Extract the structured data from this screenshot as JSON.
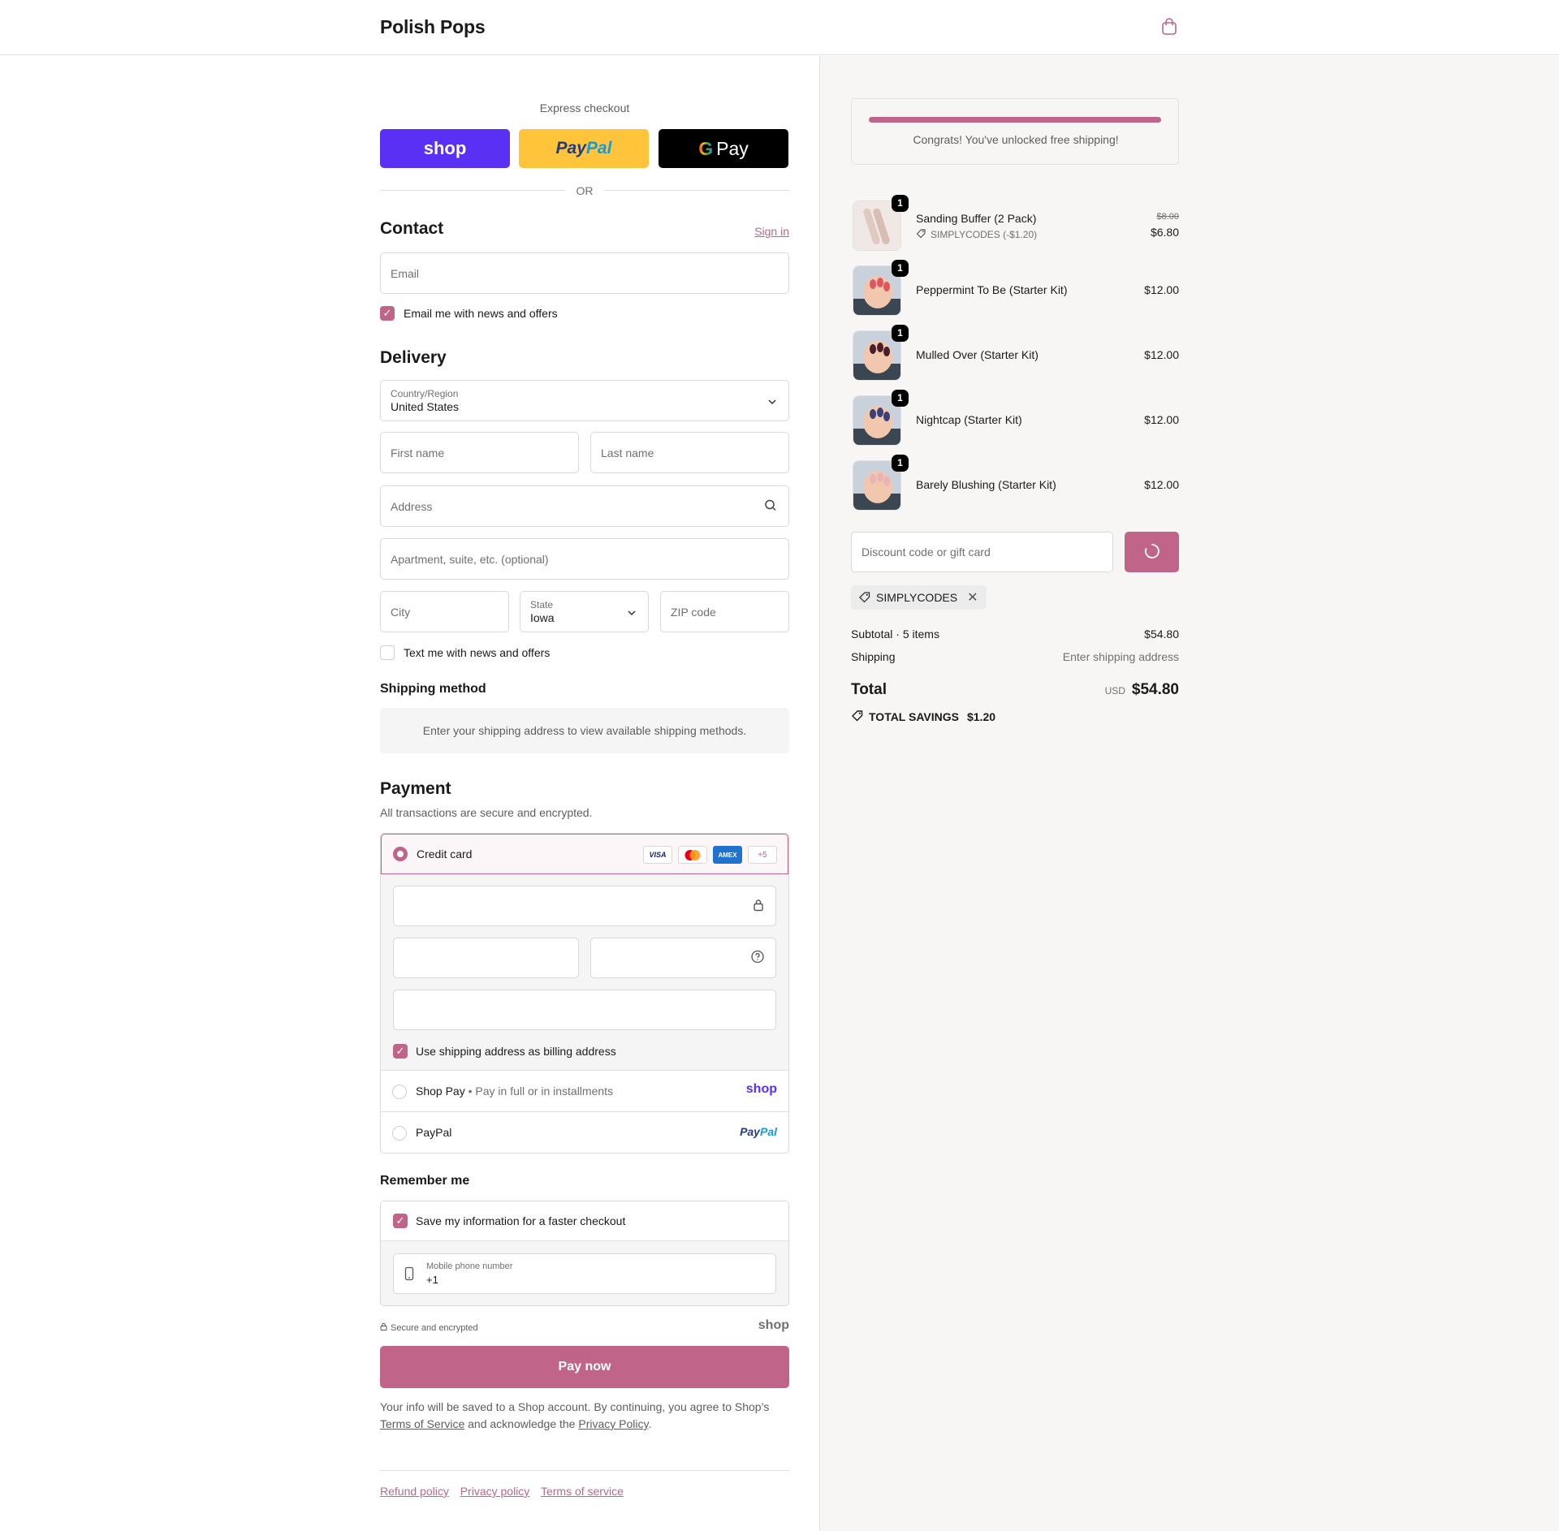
{
  "header": {
    "brand": "Polish Pops",
    "cart_icon": "shopping-bag-icon"
  },
  "express": {
    "title": "Express checkout",
    "shop_label": "shop",
    "paypal_label": "PayPal",
    "gpay_label": "Pay",
    "or_label": "OR"
  },
  "contact": {
    "title": "Contact",
    "sign_in": "Sign in",
    "email_placeholder": "Email",
    "newsletter_label": "Email me with news and offers",
    "newsletter_checked": true
  },
  "delivery": {
    "title": "Delivery",
    "country_label": "Country/Region",
    "country_value": "United States",
    "first_name_placeholder": "First name",
    "last_name_placeholder": "Last name",
    "address_placeholder": "Address",
    "apartment_placeholder": "Apartment, suite, etc. (optional)",
    "city_placeholder": "City",
    "state_label": "State",
    "state_value": "Iowa",
    "zip_placeholder": "ZIP code",
    "sms_label": "Text me with news and offers",
    "sms_checked": false
  },
  "shipping": {
    "title": "Shipping method",
    "message": "Enter your shipping address to view available shipping methods."
  },
  "payment": {
    "title": "Payment",
    "subtitle": "All transactions are secure and encrypted.",
    "credit_card_label": "Credit card",
    "cards": [
      "VISA",
      "MC",
      "AMEX",
      "+5"
    ],
    "billing_label": "Use shipping address as billing address",
    "billing_checked": true,
    "shop_pay_label": "Shop Pay",
    "shop_pay_sub": "Pay in full or in installments",
    "shop_pay_logo": "shop",
    "paypal_label": "PayPal",
    "paypal_logo": "PayPal"
  },
  "remember": {
    "title": "Remember me",
    "save_label": "Save my information for a faster checkout",
    "save_checked": true,
    "phone_label": "Mobile phone number",
    "phone_value": "+1",
    "secure_label": "Secure and encrypted",
    "shop_logo": "shop"
  },
  "pay_now": "Pay now",
  "legal": {
    "part1": "Your info will be saved to a Shop account. By continuing, you agree to Shop’s",
    "terms": "Terms of Service",
    "part2": "and acknowledge the",
    "privacy": "Privacy Policy",
    "end": "."
  },
  "footer": [
    "Refund policy",
    "Privacy policy",
    "Terms of service"
  ],
  "summary": {
    "promo_text": "Congrats! You've unlocked free shipping!",
    "promo_progress": 1.0,
    "items": [
      {
        "name": "Sanding Buffer (2 Pack)",
        "qty": "1",
        "original_price": "$8.00",
        "price": "$6.80",
        "discount": "SIMPLYCODES (-$1.20)",
        "thumb_color": "#e9dcd6"
      },
      {
        "name": "Peppermint To Be (Starter Kit)",
        "qty": "1",
        "price": "$12.00",
        "thumb_color": "#e0565f"
      },
      {
        "name": "Mulled Over (Starter Kit)",
        "qty": "1",
        "price": "$12.00",
        "thumb_color": "#4a1f2a"
      },
      {
        "name": "Nightcap (Starter Kit)",
        "qty": "1",
        "price": "$12.00",
        "thumb_color": "#3b3f7a"
      },
      {
        "name": "Barely Blushing (Starter Kit)",
        "qty": "1",
        "price": "$12.00",
        "thumb_color": "#e8b4b4"
      }
    ],
    "discount_placeholder": "Discount code or gift card",
    "applied_code": "SIMPLYCODES",
    "subtotal_label": "Subtotal · 5 items",
    "subtotal_value": "$54.80",
    "shipping_label": "Shipping",
    "shipping_value": "Enter shipping address",
    "total_label": "Total",
    "currency": "USD",
    "total_value": "$54.80",
    "savings_label": "TOTAL SAVINGS",
    "savings_value": "$1.20"
  },
  "colors": {
    "accent": "#c1648a",
    "shop": "#5a31f4",
    "paypal": "#ffc439"
  }
}
